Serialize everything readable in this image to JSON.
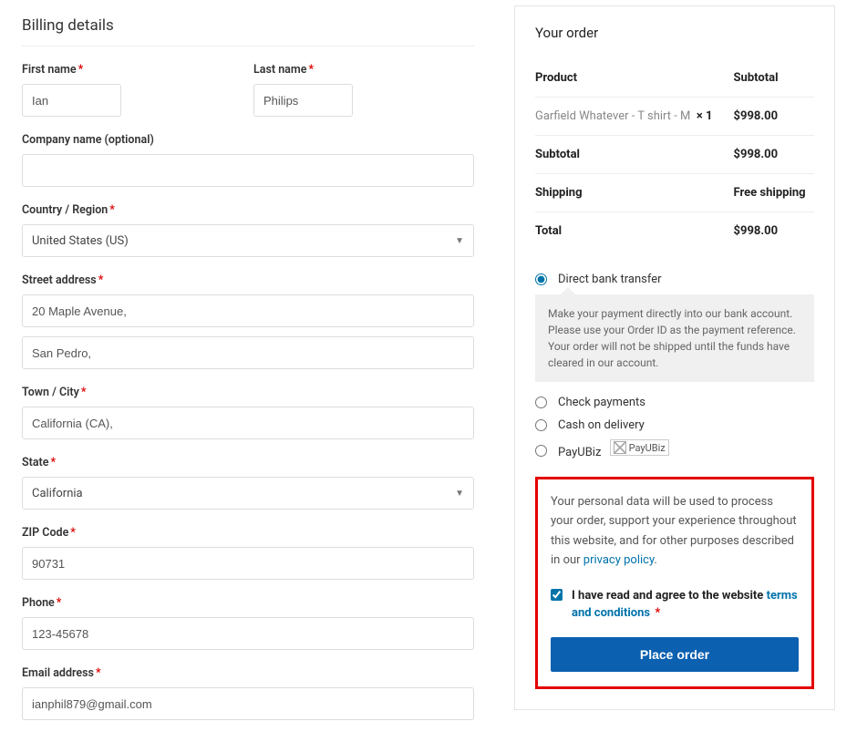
{
  "billing": {
    "title": "Billing details",
    "first_name": {
      "label": "First name",
      "value": "Ian",
      "required": true
    },
    "last_name": {
      "label": "Last name",
      "value": "Philips",
      "required": true
    },
    "company": {
      "label": "Company name (optional)",
      "value": "",
      "required": false
    },
    "country": {
      "label": "Country / Region",
      "value": "United States (US)",
      "required": true
    },
    "street1": {
      "label": "Street address",
      "value": "20 Maple Avenue,",
      "required": true
    },
    "street2": {
      "value": "San Pedro,"
    },
    "city": {
      "label": "Town / City",
      "value": "California (CA),",
      "required": true
    },
    "state": {
      "label": "State",
      "value": "California",
      "required": true
    },
    "zip": {
      "label": "ZIP Code",
      "value": "90731",
      "required": true
    },
    "phone": {
      "label": "Phone",
      "value": "123-45678",
      "required": true
    },
    "email": {
      "label": "Email address",
      "value": "ianphil879@gmail.com",
      "required": true
    }
  },
  "order": {
    "title": "Your order",
    "headers": {
      "product": "Product",
      "subtotal": "Subtotal"
    },
    "line_items": [
      {
        "name": "Garfield Whatever - T shirt - M",
        "qty": "× 1",
        "price": "$998.00"
      }
    ],
    "subtotal": {
      "label": "Subtotal",
      "value": "$998.00"
    },
    "shipping": {
      "label": "Shipping",
      "value": "Free shipping"
    },
    "total": {
      "label": "Total",
      "value": "$998.00"
    }
  },
  "payments": {
    "options": [
      {
        "id": "bank",
        "label": "Direct bank transfer",
        "selected": true,
        "desc": "Make your payment directly into our bank account. Please use your Order ID as the payment reference. Your order will not be shipped until the funds have cleared in our account."
      },
      {
        "id": "check",
        "label": "Check payments",
        "selected": false
      },
      {
        "id": "cod",
        "label": "Cash on delivery",
        "selected": false
      },
      {
        "id": "payubiz",
        "label": "PayUBiz",
        "selected": false,
        "img_alt": "PayUBiz"
      }
    ]
  },
  "privacy": {
    "text_before": "Your personal data will be used to process your order, support your experience throughout this website, and for other purposes described in our ",
    "link": "privacy policy",
    "after": "."
  },
  "terms": {
    "checked": true,
    "text_before": "I have read and agree to the website ",
    "link": "terms and conditions",
    "required_mark": "*"
  },
  "place_order": "Place order"
}
